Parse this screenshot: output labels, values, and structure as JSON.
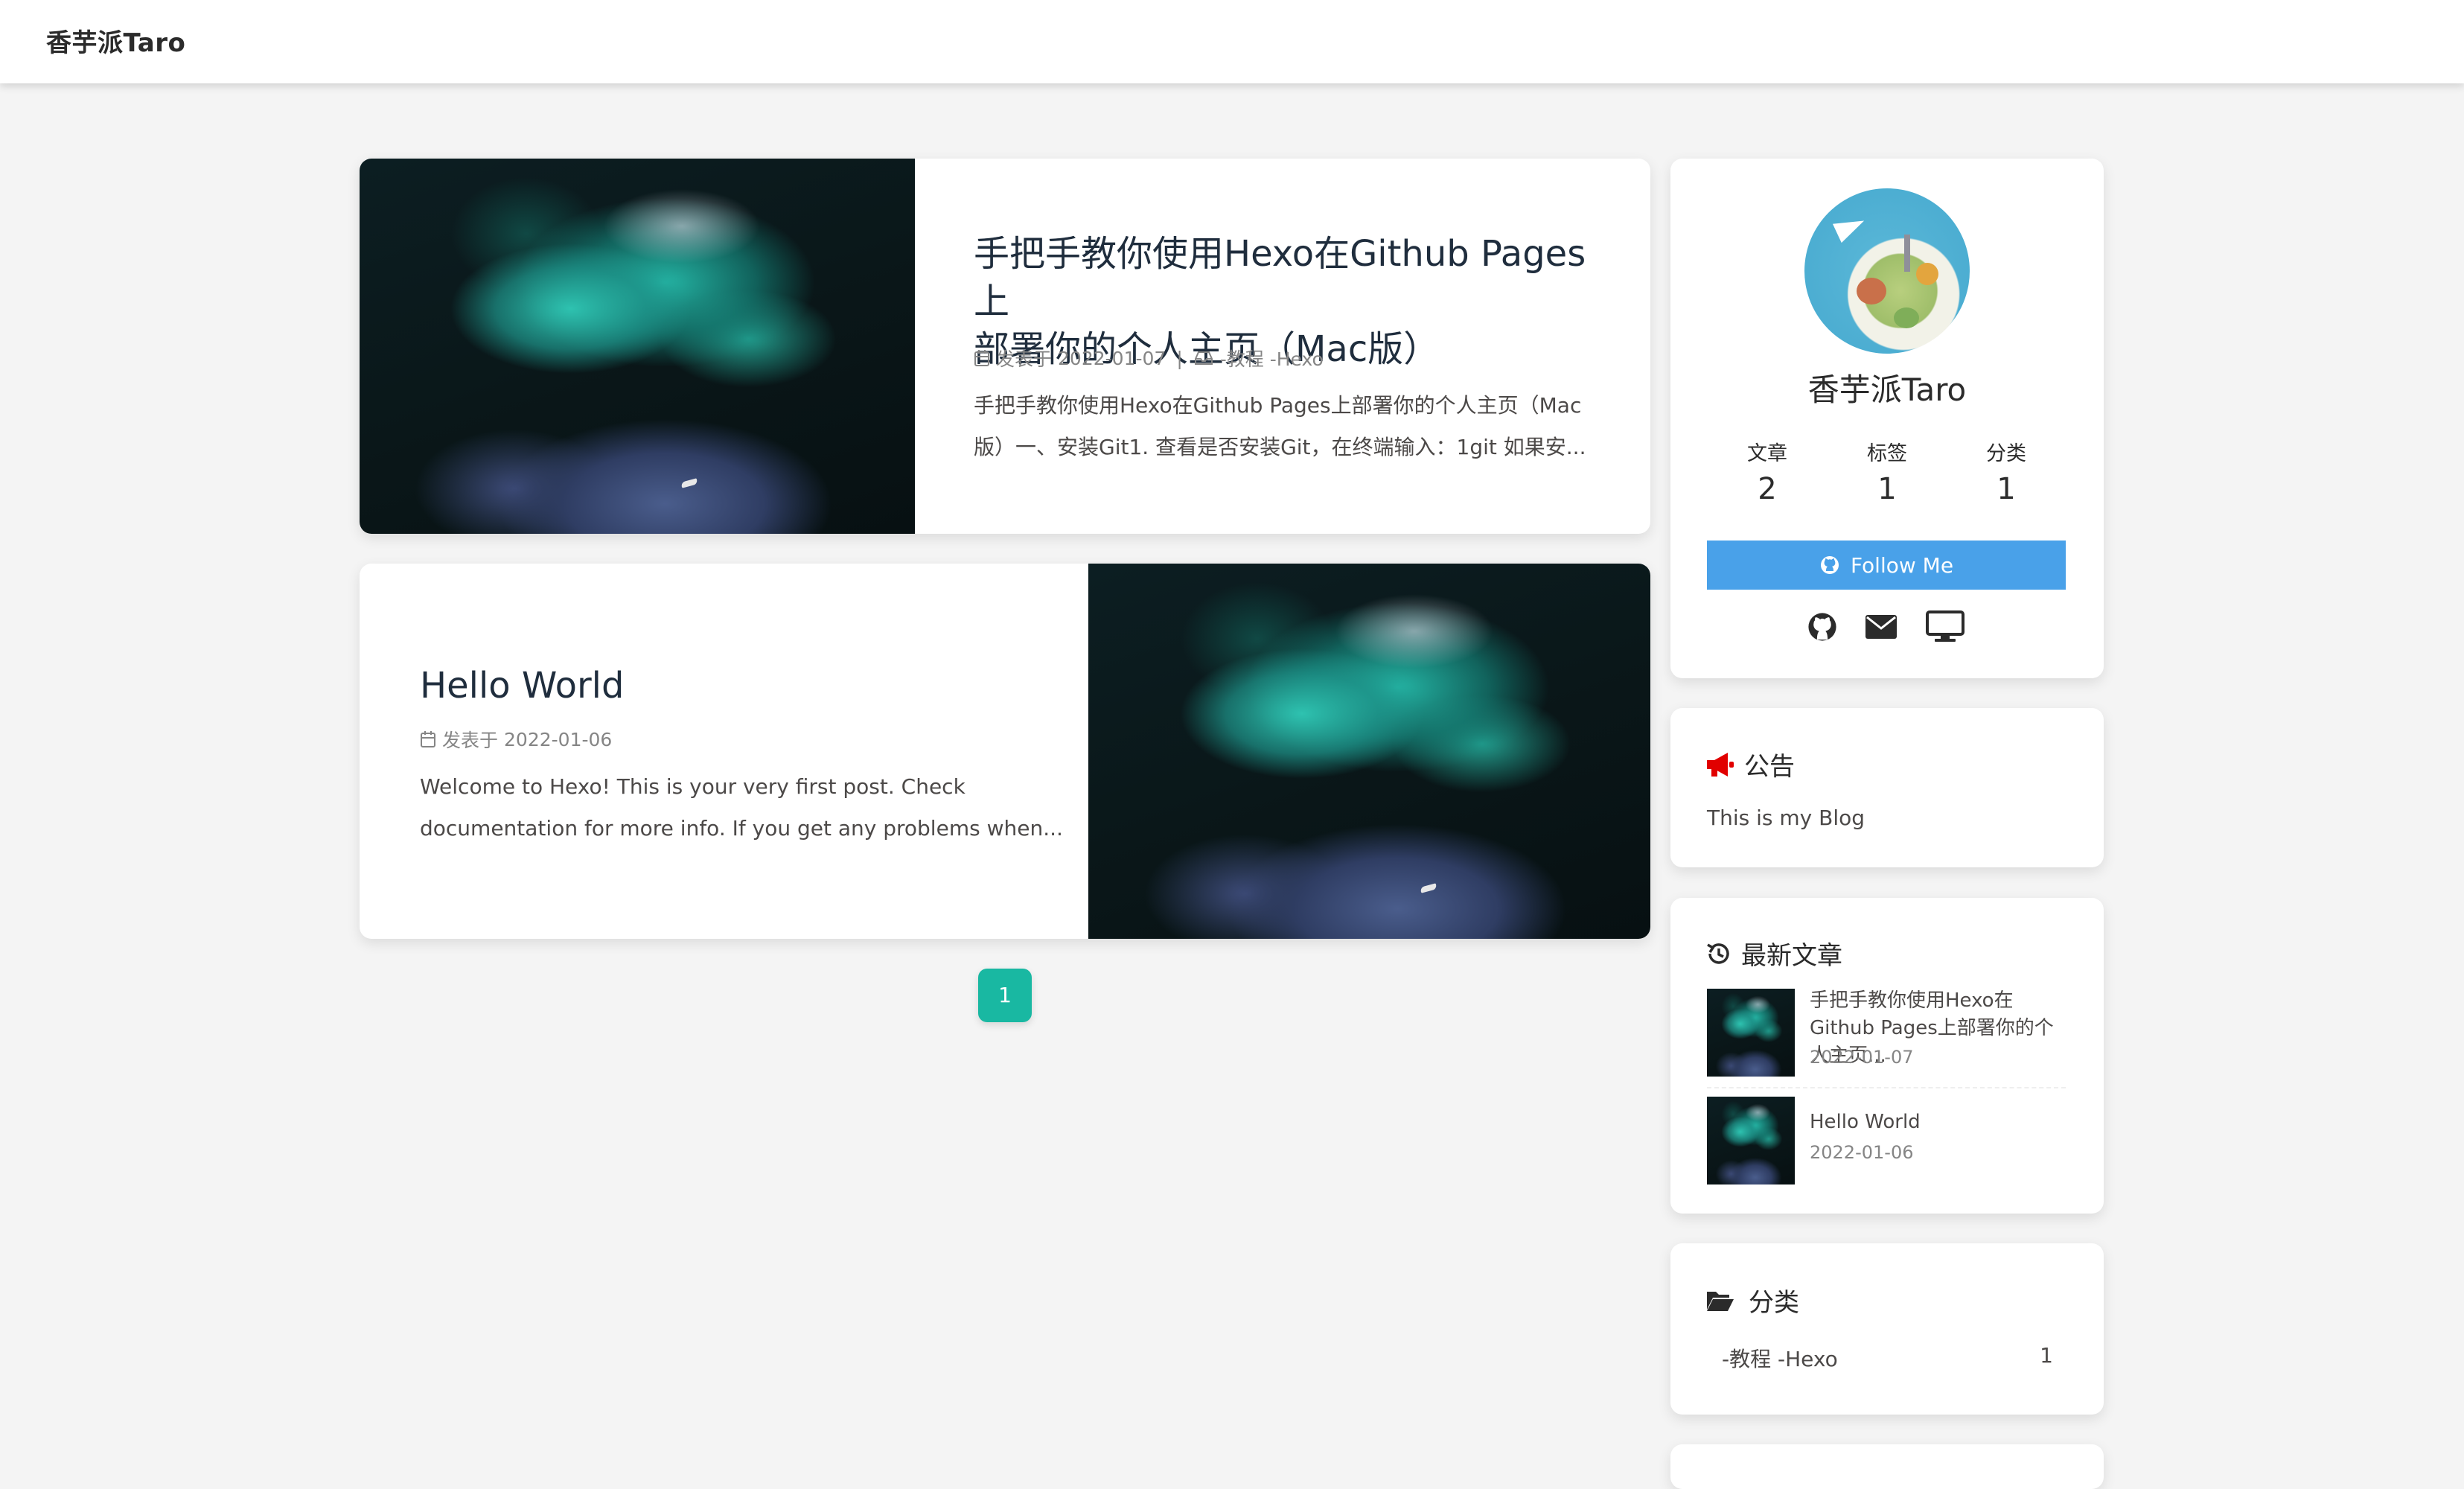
{
  "nav": {
    "brand": "香芋派Taro"
  },
  "posts": [
    {
      "title_line1": "手把手教你使用Hexo在Github Pages上",
      "title_line2": "部署你的个人主页（Mac版）",
      "meta_prefix": "发表于",
      "date": "2022-01-07",
      "separator": "|",
      "category": "-教程 -Hexo",
      "excerpt_line1": "手把手教你使用Hexo在Github Pages上部署你的个人主页（Mac",
      "excerpt_line2": "版）一、安装Git1. 查看是否安装Git，在终端输入：1git 如果安..."
    },
    {
      "title": "Hello World",
      "meta_prefix": "发表于",
      "date": "2022-01-06",
      "excerpt_line1": "Welcome to Hexo! This is your very first post. Check",
      "excerpt_line2": "documentation for more info. If you get any problems when..."
    }
  ],
  "pagination": {
    "current": "1"
  },
  "author": {
    "name": "香芋派Taro",
    "stats": [
      {
        "label": "文章",
        "value": "2"
      },
      {
        "label": "标签",
        "value": "1"
      },
      {
        "label": "分类",
        "value": "1"
      }
    ],
    "follow_label": "Follow Me",
    "social_icons": [
      "github-icon",
      "envelope-icon",
      "desktop-icon"
    ]
  },
  "announcement": {
    "heading": "公告",
    "text": "This is my Blog"
  },
  "recent": {
    "heading": "最新文章",
    "items": [
      {
        "title": "手把手教你使用Hexo在Github Pages上部署你的个人主页...",
        "date": "2022-01-07"
      },
      {
        "title": "Hello World",
        "date": "2022-01-06"
      }
    ]
  },
  "categories": {
    "heading": "分类",
    "items": [
      {
        "name": "-教程 -Hexo",
        "count": "1"
      }
    ]
  },
  "colors": {
    "accent_teal": "#19b8a2",
    "follow_blue": "#49a1e9",
    "announcement_red": "#e10000",
    "text_dark": "#1f2d3d",
    "meta_grey": "#858585"
  }
}
